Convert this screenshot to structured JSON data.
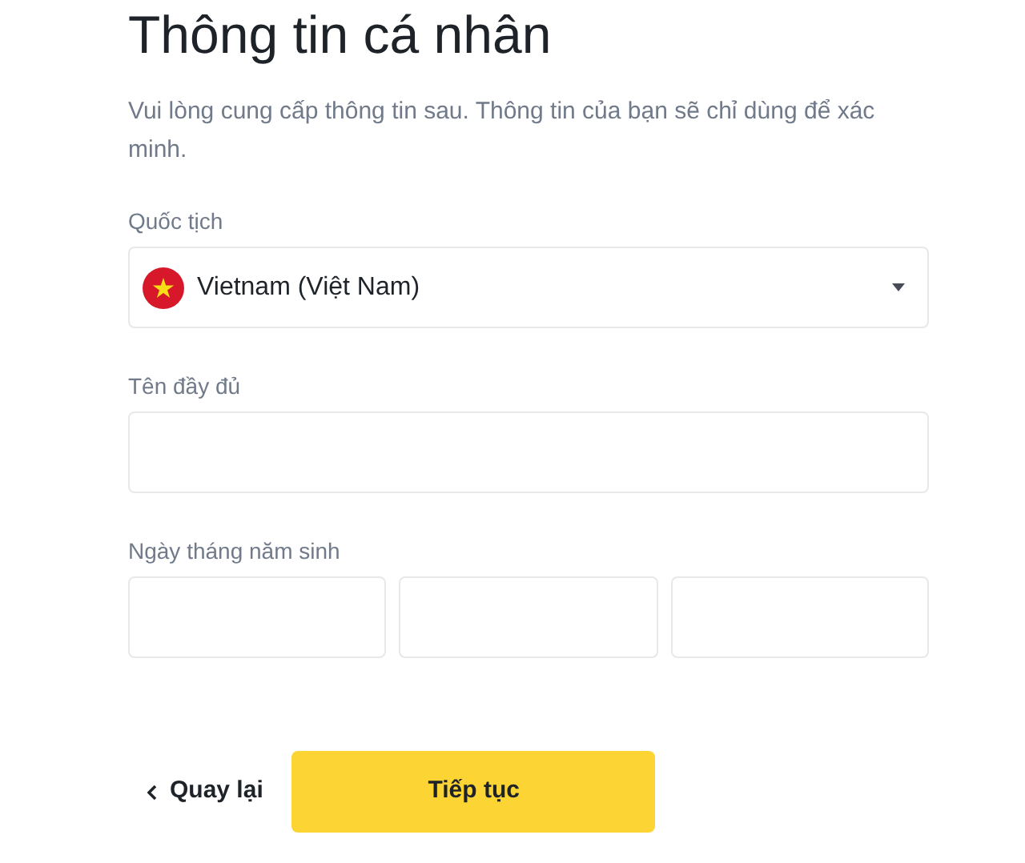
{
  "title": "Thông tin cá nhân",
  "description": "Vui lòng cung cấp thông tin sau. Thông tin của bạn sẽ chỉ dùng để xác minh.",
  "nationality": {
    "label": "Quốc tịch",
    "value": "Vietnam (Việt Nam)"
  },
  "full_name": {
    "label": "Tên đầy đủ"
  },
  "birth_date": {
    "label": "Ngày tháng năm sinh"
  },
  "back_button": {
    "label": "Quay lại"
  },
  "continue_button": {
    "label": "Tiếp tục"
  }
}
